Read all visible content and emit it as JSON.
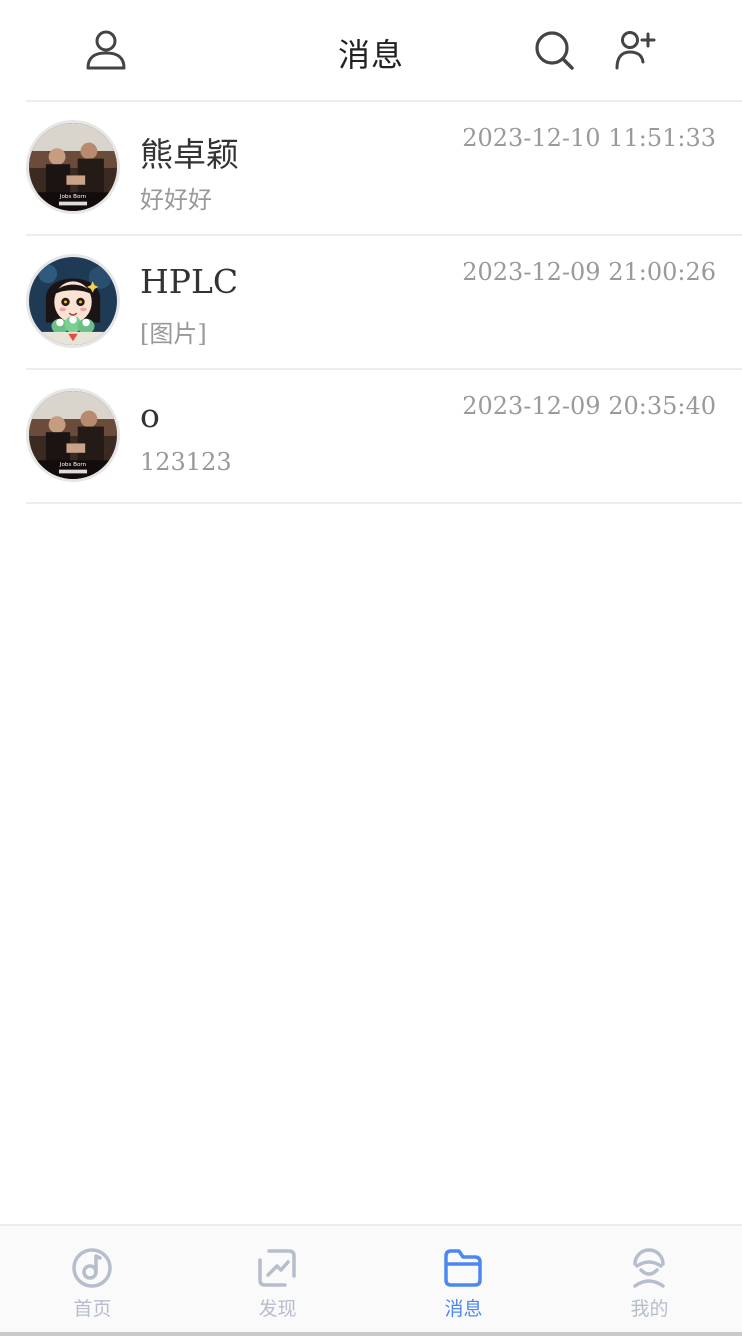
{
  "header": {
    "title": "消息",
    "profile_icon": "user-outline-icon",
    "search_icon": "search-icon",
    "add_friend_icon": "add-user-icon"
  },
  "messages": [
    {
      "name": "熊卓颖",
      "preview": "好好好",
      "time": "2023-12-10 11:51:33",
      "avatar": "photo-two-people",
      "avatar_caption": "Jobs Born"
    },
    {
      "name": "HPLC",
      "preview": "[图片]",
      "time": "2023-12-09 21:00:26",
      "avatar": "cartoon-girl"
    },
    {
      "name": "o",
      "preview": "123123",
      "time": "2023-12-09 20:35:40",
      "avatar": "photo-two-people",
      "avatar_caption": "Jobs Born"
    }
  ],
  "tabbar": {
    "tabs": [
      {
        "label": "首页",
        "icon": "music-disc-icon",
        "active": false
      },
      {
        "label": "发现",
        "icon": "discover-icon",
        "active": false
      },
      {
        "label": "消息",
        "icon": "folder-icon",
        "active": true
      },
      {
        "label": "我的",
        "icon": "profile-face-icon",
        "active": false
      }
    ]
  },
  "colors": {
    "active": "#4f87f1",
    "inactive": "#b6bdcc",
    "time_text": "#9a9a9a",
    "divider": "#ececec"
  }
}
